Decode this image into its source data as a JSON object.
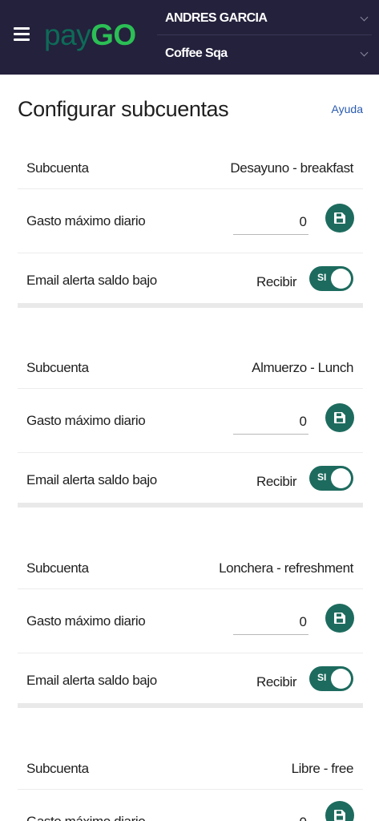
{
  "header": {
    "logo_part1": "pay",
    "logo_part2": "GO",
    "user_name": "ANDRES GARCIA",
    "store_name": "Coffee Sqa",
    "menu_icon": "hamburger-icon",
    "dropdown_icon": "chevron-down-icon",
    "colors": {
      "bar": "#24213c",
      "logo_pay": "#0d6b58",
      "logo_go": "#2bbf55"
    }
  },
  "page": {
    "title": "Configurar subcuentas",
    "help_link": "Ayuda"
  },
  "labels": {
    "subaccount": "Subcuenta",
    "daily_max": "Gasto máximo diario",
    "low_balance_alert": "Email alerta saldo bajo",
    "receive": "Recibir",
    "toggle_on": "SI"
  },
  "accent_color": "#1d6b5e",
  "save_icon": "floppy-disk-icon",
  "subaccounts": [
    {
      "name": "Desayuno - breakfast",
      "daily_max": "0",
      "alert_enabled": true
    },
    {
      "name": "Almuerzo - Lunch",
      "daily_max": "0",
      "alert_enabled": true
    },
    {
      "name": "Lonchera - refreshment",
      "daily_max": "0",
      "alert_enabled": true
    },
    {
      "name": "Libre - free",
      "daily_max": "0"
    }
  ]
}
